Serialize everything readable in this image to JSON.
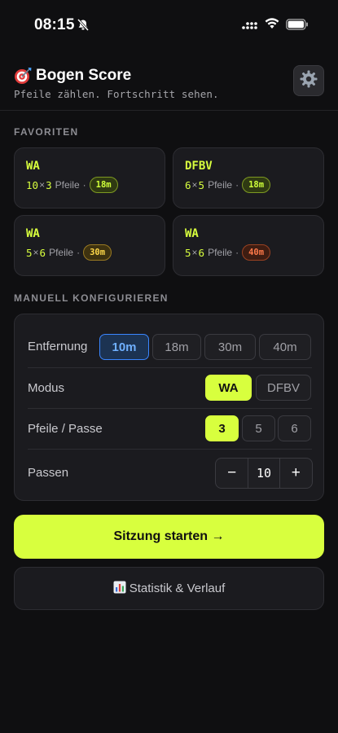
{
  "status": {
    "time": "08:15"
  },
  "app": {
    "title": "Bogen Score",
    "subtitle": "Pfeile zählen. Fortschritt sehen."
  },
  "favorites": {
    "label": "FAVORITEN",
    "items": [
      {
        "name": "WA",
        "passes": "10",
        "arrows": "3",
        "unit": "Pfeile",
        "distance": "18m",
        "badge_color": "#cfff3a"
      },
      {
        "name": "DFBV",
        "passes": "6",
        "arrows": "5",
        "unit": "Pfeile",
        "distance": "18m",
        "badge_color": "#cfff3a"
      },
      {
        "name": "WA",
        "passes": "5",
        "arrows": "6",
        "unit": "Pfeile",
        "distance": "30m",
        "badge_color": "#ffd84a"
      },
      {
        "name": "WA",
        "passes": "5",
        "arrows": "6",
        "unit": "Pfeile",
        "distance": "40m",
        "badge_color": "#ff7a4a"
      }
    ]
  },
  "manual": {
    "label": "MANUELL KONFIGURIEREN",
    "distance": {
      "label": "Entfernung",
      "options": [
        "10m",
        "18m",
        "30m",
        "40m"
      ],
      "selected": "10m"
    },
    "mode": {
      "label": "Modus",
      "options": [
        "WA",
        "DFBV"
      ],
      "selected": "WA"
    },
    "arrows": {
      "label": "Pfeile / Passe",
      "options": [
        "3",
        "5",
        "6"
      ],
      "selected": "3"
    },
    "passes": {
      "label": "Passen",
      "value": "10",
      "minus": "−",
      "plus": "+"
    }
  },
  "actions": {
    "start": "Sitzung starten →",
    "stats": "Statistik & Verlauf"
  },
  "colors": {
    "accent": "#d8ff3e",
    "selected_blue": "#3a86ff",
    "background": "#0f0f11",
    "card": "#1b1b1f"
  }
}
